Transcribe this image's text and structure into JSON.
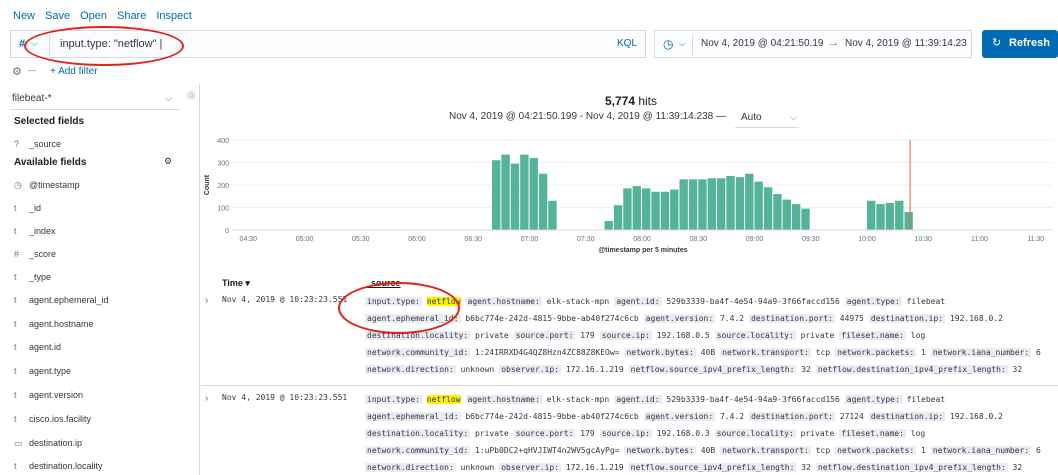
{
  "topnav": [
    "New",
    "Save",
    "Open",
    "Share",
    "Inspect"
  ],
  "query": {
    "hash": "#",
    "text": "input.type: \"netflow\" |",
    "language": "KQL"
  },
  "time": {
    "start": "Nov 4, 2019 @ 04:21:50.19",
    "arrow": "→",
    "end": "Nov 4, 2019 @ 11:39:14.23"
  },
  "refresh": {
    "icon": "↻",
    "label": "Refresh"
  },
  "filter": {
    "add_label": "+ Add filter"
  },
  "sidebar": {
    "index_pattern": "filebeat-*",
    "selected_header": "Selected fields",
    "selected": [
      {
        "type": "?",
        "name": "_source"
      }
    ],
    "available_header": "Available fields",
    "available": [
      {
        "type": "◷",
        "name": "@timestamp"
      },
      {
        "type": "t",
        "name": "_id"
      },
      {
        "type": "t",
        "name": "_index"
      },
      {
        "type": "#",
        "name": "_score"
      },
      {
        "type": "t",
        "name": "_type"
      },
      {
        "type": "t",
        "name": "agent.ephemeral_id"
      },
      {
        "type": "t",
        "name": "agent.hostname"
      },
      {
        "type": "t",
        "name": "agent.id"
      },
      {
        "type": "t",
        "name": "agent.type"
      },
      {
        "type": "t",
        "name": "agent.version"
      },
      {
        "type": "t",
        "name": "cisco.ios.facility"
      },
      {
        "type": "▭",
        "name": "destination.ip"
      },
      {
        "type": "t",
        "name": "destination.locality"
      }
    ]
  },
  "hits": {
    "count": "5,774",
    "label": "hits"
  },
  "range_text": "Nov 4, 2019 @ 04:21:50.199 - Nov 4, 2019 @ 11:39:14.238 —",
  "interval": "Auto",
  "chart_data": {
    "type": "bar",
    "ylabel": "Count",
    "xlabel": "@timestamp per 5 minutes",
    "ylim": [
      0,
      400
    ],
    "yticks": [
      0,
      100,
      200,
      300,
      400
    ],
    "xticks": [
      "04:30",
      "05:00",
      "05:30",
      "06:00",
      "06:30",
      "07:00",
      "07:30",
      "08:00",
      "08:30",
      "09:00",
      "09:30",
      "10:00",
      "10:30",
      "11:00",
      "11:30"
    ],
    "x_start_minutes": 261.83,
    "x_end_minutes": 699.23,
    "bar_minutes": 5,
    "bars": [
      {
        "t": 400,
        "v": 310
      },
      {
        "t": 405,
        "v": 335
      },
      {
        "t": 410,
        "v": 295
      },
      {
        "t": 415,
        "v": 335
      },
      {
        "t": 420,
        "v": 320
      },
      {
        "t": 425,
        "v": 250
      },
      {
        "t": 430,
        "v": 130
      },
      {
        "t": 460,
        "v": 40
      },
      {
        "t": 465,
        "v": 110
      },
      {
        "t": 470,
        "v": 185
      },
      {
        "t": 475,
        "v": 195
      },
      {
        "t": 480,
        "v": 185
      },
      {
        "t": 485,
        "v": 170
      },
      {
        "t": 490,
        "v": 170
      },
      {
        "t": 495,
        "v": 180
      },
      {
        "t": 500,
        "v": 225
      },
      {
        "t": 505,
        "v": 225
      },
      {
        "t": 510,
        "v": 225
      },
      {
        "t": 515,
        "v": 230
      },
      {
        "t": 520,
        "v": 230
      },
      {
        "t": 525,
        "v": 240
      },
      {
        "t": 530,
        "v": 235
      },
      {
        "t": 535,
        "v": 250
      },
      {
        "t": 540,
        "v": 215
      },
      {
        "t": 545,
        "v": 190
      },
      {
        "t": 550,
        "v": 160
      },
      {
        "t": 555,
        "v": 135
      },
      {
        "t": 560,
        "v": 115
      },
      {
        "t": 565,
        "v": 95
      },
      {
        "t": 600,
        "v": 130
      },
      {
        "t": 605,
        "v": 115
      },
      {
        "t": 610,
        "v": 120
      },
      {
        "t": 615,
        "v": 130
      },
      {
        "t": 620,
        "v": 80
      }
    ],
    "now_marker_minutes": 623,
    "bar_color": "#54b399",
    "marker_color": "#e7664c"
  },
  "table": {
    "col_time": "Time ▾",
    "col_source": "_source",
    "rows": [
      {
        "time": "Nov 4, 2019 @ 10:23:23.551",
        "lines": [
          [
            {
              "k": "input.type:",
              "v": "netflow",
              "hl": true
            },
            {
              "k": "agent.hostname:",
              "v": "elk-stack-mpn"
            },
            {
              "k": "agent.id:",
              "v": "529b3339-ba4f-4e54-94a9-3f66faccd156"
            },
            {
              "k": "agent.type:",
              "v": "filebeat"
            }
          ],
          [
            {
              "k": "agent.ephemeral_id:",
              "v": "b6bc774e-242d-4815-9bbe-ab40f274c6cb"
            },
            {
              "k": "agent.version:",
              "v": "7.4.2"
            },
            {
              "k": "destination.port:",
              "v": "44975"
            },
            {
              "k": "destination.ip:",
              "v": "192.168.0.2"
            }
          ],
          [
            {
              "k": "destination.locality:",
              "v": "private"
            },
            {
              "k": "source.port:",
              "v": "179"
            },
            {
              "k": "source.ip:",
              "v": "192.168.0.5"
            },
            {
              "k": "source.locality:",
              "v": "private"
            },
            {
              "k": "fileset.name:",
              "v": "log"
            }
          ],
          [
            {
              "k": "network.community_id:",
              "v": "1:24IRRXD4G4QZ8Hzn4ZC88Z8KEOw="
            },
            {
              "k": "network.bytes:",
              "v": "40B"
            },
            {
              "k": "network.transport:",
              "v": "tcp"
            },
            {
              "k": "network.packets:",
              "v": "1"
            },
            {
              "k": "network.iana_number:",
              "v": "6"
            }
          ],
          [
            {
              "k": "network.direction:",
              "v": "unknown"
            },
            {
              "k": "observer.ip:",
              "v": "172.16.1.219"
            },
            {
              "k": "netflow.source_ipv4_prefix_length:",
              "v": "32"
            },
            {
              "k": "netflow.destination_ipv4_prefix_length:",
              "v": "32"
            }
          ]
        ]
      },
      {
        "time": "Nov 4, 2019 @ 10:23:23.551",
        "lines": [
          [
            {
              "k": "input.type:",
              "v": "netflow",
              "hl": true
            },
            {
              "k": "agent.hostname:",
              "v": "elk-stack-mpn"
            },
            {
              "k": "agent.id:",
              "v": "529b3339-ba4f-4e54-94a9-3f66faccd156"
            },
            {
              "k": "agent.type:",
              "v": "filebeat"
            }
          ],
          [
            {
              "k": "agent.ephemeral_id:",
              "v": "b6bc774e-242d-4815-9bbe-ab40f274c6cb"
            },
            {
              "k": "agent.version:",
              "v": "7.4.2"
            },
            {
              "k": "destination.port:",
              "v": "27124"
            },
            {
              "k": "destination.ip:",
              "v": "192.168.0.2"
            }
          ],
          [
            {
              "k": "destination.locality:",
              "v": "private"
            },
            {
              "k": "source.port:",
              "v": "179"
            },
            {
              "k": "source.ip:",
              "v": "192.168.0.3"
            },
            {
              "k": "source.locality:",
              "v": "private"
            },
            {
              "k": "fileset.name:",
              "v": "log"
            }
          ],
          [
            {
              "k": "network.community_id:",
              "v": "1:uPb0DC2+qHVJIWT4n2WV5gcAyPg="
            },
            {
              "k": "network.bytes:",
              "v": "40B"
            },
            {
              "k": "network.transport:",
              "v": "tcp"
            },
            {
              "k": "network.packets:",
              "v": "1"
            },
            {
              "k": "network.iana_number:",
              "v": "6"
            }
          ],
          [
            {
              "k": "network.direction:",
              "v": "unknown"
            },
            {
              "k": "observer.ip:",
              "v": "172.16.1.219"
            },
            {
              "k": "netflow.source_ipv4_prefix_length:",
              "v": "32"
            },
            {
              "k": "netflow.destination_ipv4_prefix_length:",
              "v": "32"
            }
          ]
        ]
      }
    ]
  }
}
